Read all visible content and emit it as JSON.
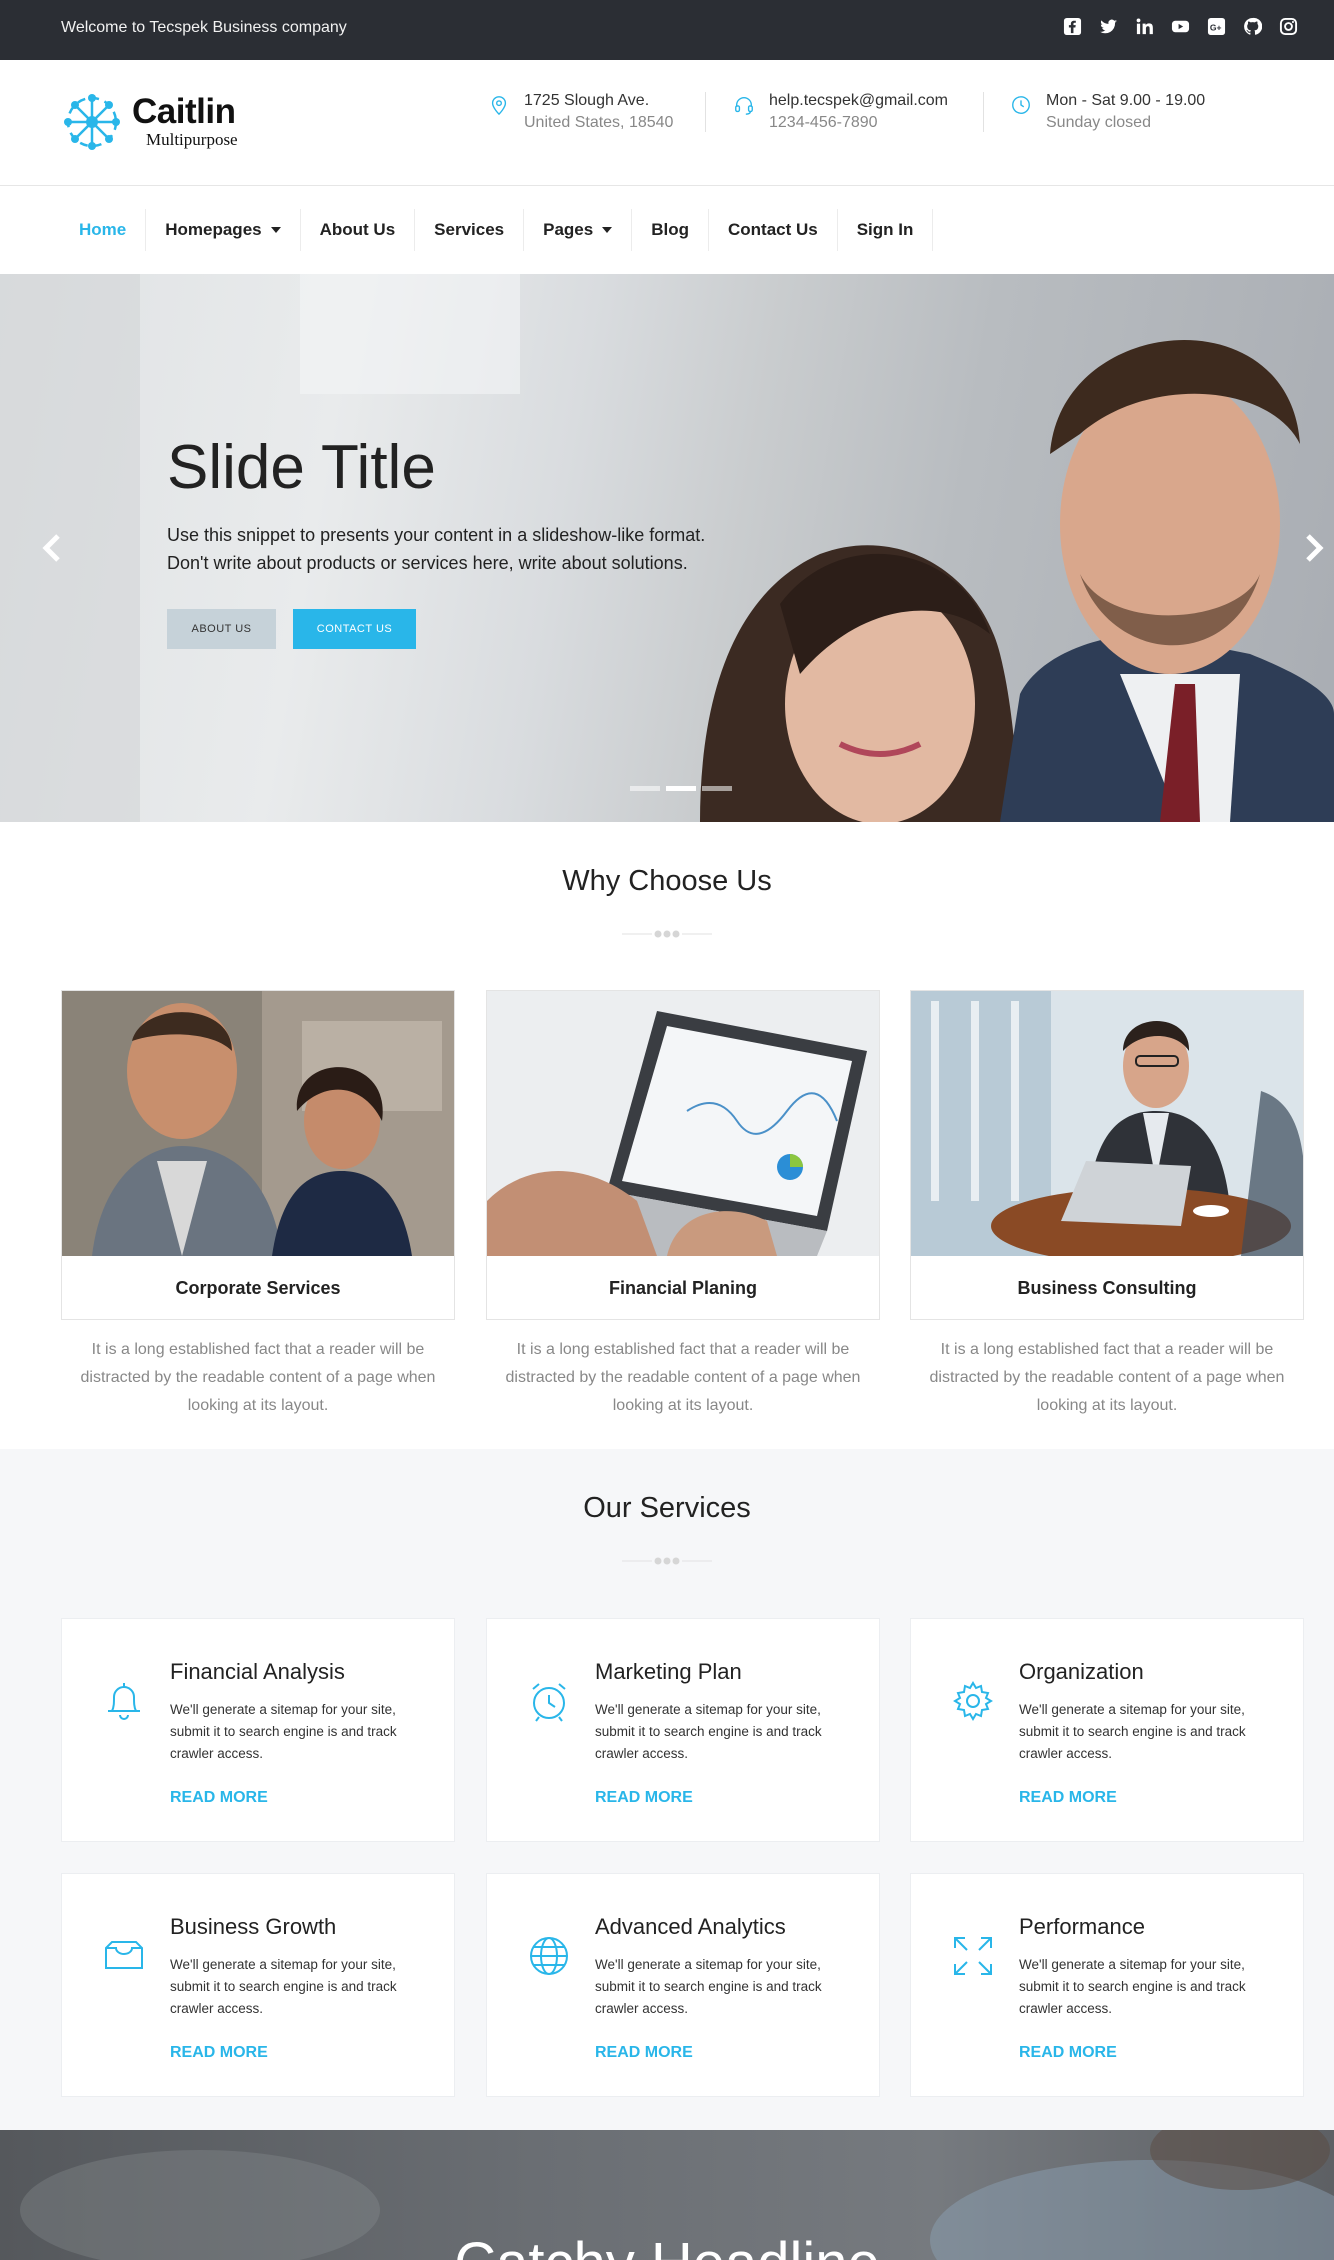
{
  "topbar": {
    "welcome": "Welcome to Tecspek Business company",
    "social": [
      "facebook-icon",
      "twitter-icon",
      "linkedin-icon",
      "youtube-icon",
      "google-plus-icon",
      "github-icon",
      "instagram-icon"
    ]
  },
  "logo": {
    "name": "Caitlin",
    "tagline": "Multipurpose"
  },
  "contact": [
    {
      "icon": "location-pin-icon",
      "line1": "1725 Slough Ave.",
      "line2": "United States, 18540"
    },
    {
      "icon": "headset-icon",
      "line1": "help.tecspek@gmail.com",
      "line2": "1234-456-7890"
    },
    {
      "icon": "clock-icon",
      "line1": "Mon - Sat 9.00 - 19.00",
      "line2": "Sunday closed"
    }
  ],
  "nav": [
    "Home",
    "Homepages",
    "About Us",
    "Services",
    "Pages",
    "Blog",
    "Contact Us",
    "Sign In"
  ],
  "hero": {
    "title": "Slide Title",
    "desc1": "Use this snippet to presents your content in a slideshow-like format.",
    "desc2": "Don't write about products or services here, write about solutions.",
    "btn1": "ABOUT US",
    "btn2": "CONTACT US"
  },
  "why": {
    "title": "Why Choose Us",
    "cards": [
      {
        "title": "Corporate Services",
        "desc": "It is a long established fact that a reader will be distracted by the readable content of a page when looking at its layout."
      },
      {
        "title": "Financial Planing",
        "desc": "It is a long established fact that a reader will be distracted by the readable content of a page when looking at its layout."
      },
      {
        "title": "Business Consulting",
        "desc": "It is a long established fact that a reader will be distracted by the readable content of a page when looking at its layout."
      }
    ]
  },
  "services": {
    "title": "Our Services",
    "items": [
      {
        "icon": "bell-icon",
        "title": "Financial Analysis",
        "desc": "We'll generate a sitemap for your site, submit it to search engine is and track crawler access.",
        "more": "READ MORE"
      },
      {
        "icon": "alarm-clock-icon",
        "title": "Marketing Plan",
        "desc": "We'll generate a sitemap for your site, submit it to search engine is and track crawler access.",
        "more": "READ MORE"
      },
      {
        "icon": "gear-icon",
        "title": "Organization",
        "desc": "We'll generate a sitemap for your site, submit it to search engine is and track crawler access.",
        "more": "READ MORE"
      },
      {
        "icon": "inbox-icon",
        "title": "Business Growth",
        "desc": "We'll generate a sitemap for your site, submit it to search engine is and track crawler access.",
        "more": "READ MORE"
      },
      {
        "icon": "globe-icon",
        "title": "Advanced Analytics",
        "desc": "We'll generate a sitemap for your site, submit it to search engine is and track crawler access.",
        "more": "READ MORE"
      },
      {
        "icon": "expand-icon",
        "title": "Performance",
        "desc": "We'll generate a sitemap for your site, submit it to search engine is and track crawler access.",
        "more": "READ MORE"
      }
    ]
  },
  "banner": {
    "title": "Catchy Headline"
  },
  "colors": {
    "accent": "#29b6e9",
    "topbar": "#2b2e34"
  }
}
